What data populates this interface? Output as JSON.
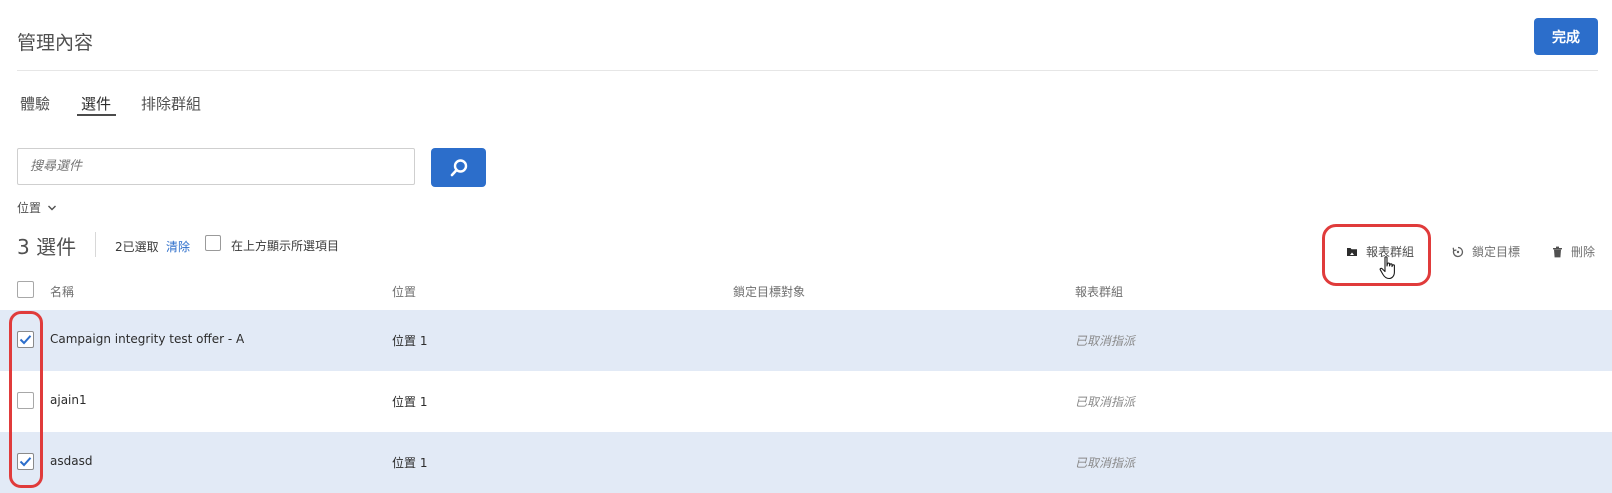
{
  "header": {
    "title": "管理內容",
    "done_label": "完成"
  },
  "tabs": [
    {
      "label": "體驗"
    },
    {
      "label": "選件",
      "active": true
    },
    {
      "label": "排除群組"
    }
  ],
  "search": {
    "placeholder": "搜尋選件"
  },
  "filter": {
    "label": "位置"
  },
  "toolbar": {
    "count": "3 選件",
    "selected": "2已選取",
    "clear": "清除",
    "show_selected_on_top": "在上方顯示所選項目",
    "actions": [
      {
        "label": "報表群組",
        "icon": "folder-icon"
      },
      {
        "label": "鎖定目標",
        "icon": "target-icon"
      },
      {
        "label": "刪除",
        "icon": "trash-icon"
      }
    ]
  },
  "table": {
    "columns": [
      "名稱",
      "位置",
      "鎖定目標對象",
      "報表群組"
    ],
    "rows": [
      {
        "name": "Campaign integrity test offer - A",
        "location": "位置 1",
        "audience": "",
        "report_group": "已取消指派",
        "selected": true
      },
      {
        "name": "ajain1",
        "location": "位置 1",
        "audience": "",
        "report_group": "已取消指派",
        "selected": false
      },
      {
        "name": "asdasd",
        "location": "位置 1",
        "audience": "",
        "report_group": "已取消指派",
        "selected": true
      }
    ]
  },
  "colors": {
    "accent": "#2c6ecb",
    "selected_row": "#e2eaf6",
    "annotation": "#e03b3b"
  }
}
